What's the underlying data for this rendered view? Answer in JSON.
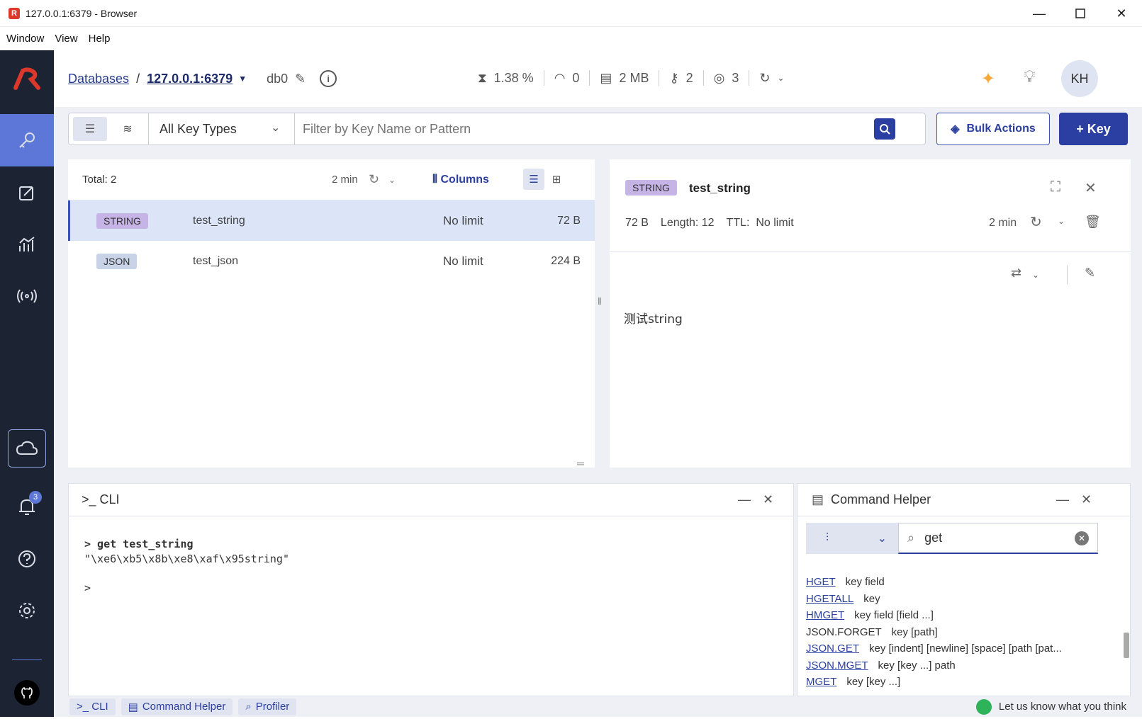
{
  "window": {
    "title": "127.0.0.1:6379 - Browser",
    "logo_letter": "R"
  },
  "menu": [
    "Window",
    "View",
    "Help"
  ],
  "header": {
    "databases": "Databases",
    "sep": "/",
    "host": "127.0.0.1:6379",
    "db": "db0",
    "cpu": "1.38 %",
    "ops": "0",
    "memory": "2 MB",
    "keys": "2",
    "clients": "3",
    "avatar": "KH"
  },
  "toolbar": {
    "key_type": "All Key Types",
    "search_placeholder": "Filter by Key Name or Pattern",
    "bulk": "Bulk Actions",
    "add_key": "+ Key"
  },
  "list": {
    "total": "Total: 2",
    "refresh": "2 min",
    "columns": "Columns",
    "rows": [
      {
        "type": "STRING",
        "name": "test_string",
        "ttl": "No limit",
        "size": "72 B",
        "color": "#c7b4e6"
      },
      {
        "type": "JSON",
        "name": "test_json",
        "ttl": "No limit",
        "size": "224 B",
        "color": "#c9d3e8"
      }
    ]
  },
  "detail": {
    "type": "STRING",
    "name": "test_string",
    "size": "72 B",
    "length": "Length: 12",
    "ttl_label": "TTL:",
    "ttl": "No limit",
    "refresh": "2 min",
    "value": "测试string"
  },
  "cli": {
    "title": ">_ CLI",
    "cmd": "> get test_string",
    "output": "\"\\xe6\\xb5\\x8b\\xe8\\xaf\\x95string\"",
    "prompt": ">"
  },
  "helper": {
    "title": "Command Helper",
    "search": "get",
    "commands": [
      {
        "name": "HGET",
        "args": "key field",
        "link": true
      },
      {
        "name": "HGETALL",
        "args": "key",
        "link": true
      },
      {
        "name": "HMGET",
        "args": "key field [field ...]",
        "link": true
      },
      {
        "name": "JSON.FORGET",
        "args": "key [path]",
        "link": false
      },
      {
        "name": "JSON.GET",
        "args": "key [indent] [newline] [space] [path [pat...",
        "link": true
      },
      {
        "name": "JSON.MGET",
        "args": "key [key ...] path",
        "link": true
      },
      {
        "name": "MGET",
        "args": "key [key ...]",
        "link": true
      }
    ]
  },
  "footer": {
    "cli": ">_ CLI",
    "helper": "Command Helper",
    "profiler": "Profiler",
    "feedback": "Let us know what you think"
  },
  "notifications": "3"
}
